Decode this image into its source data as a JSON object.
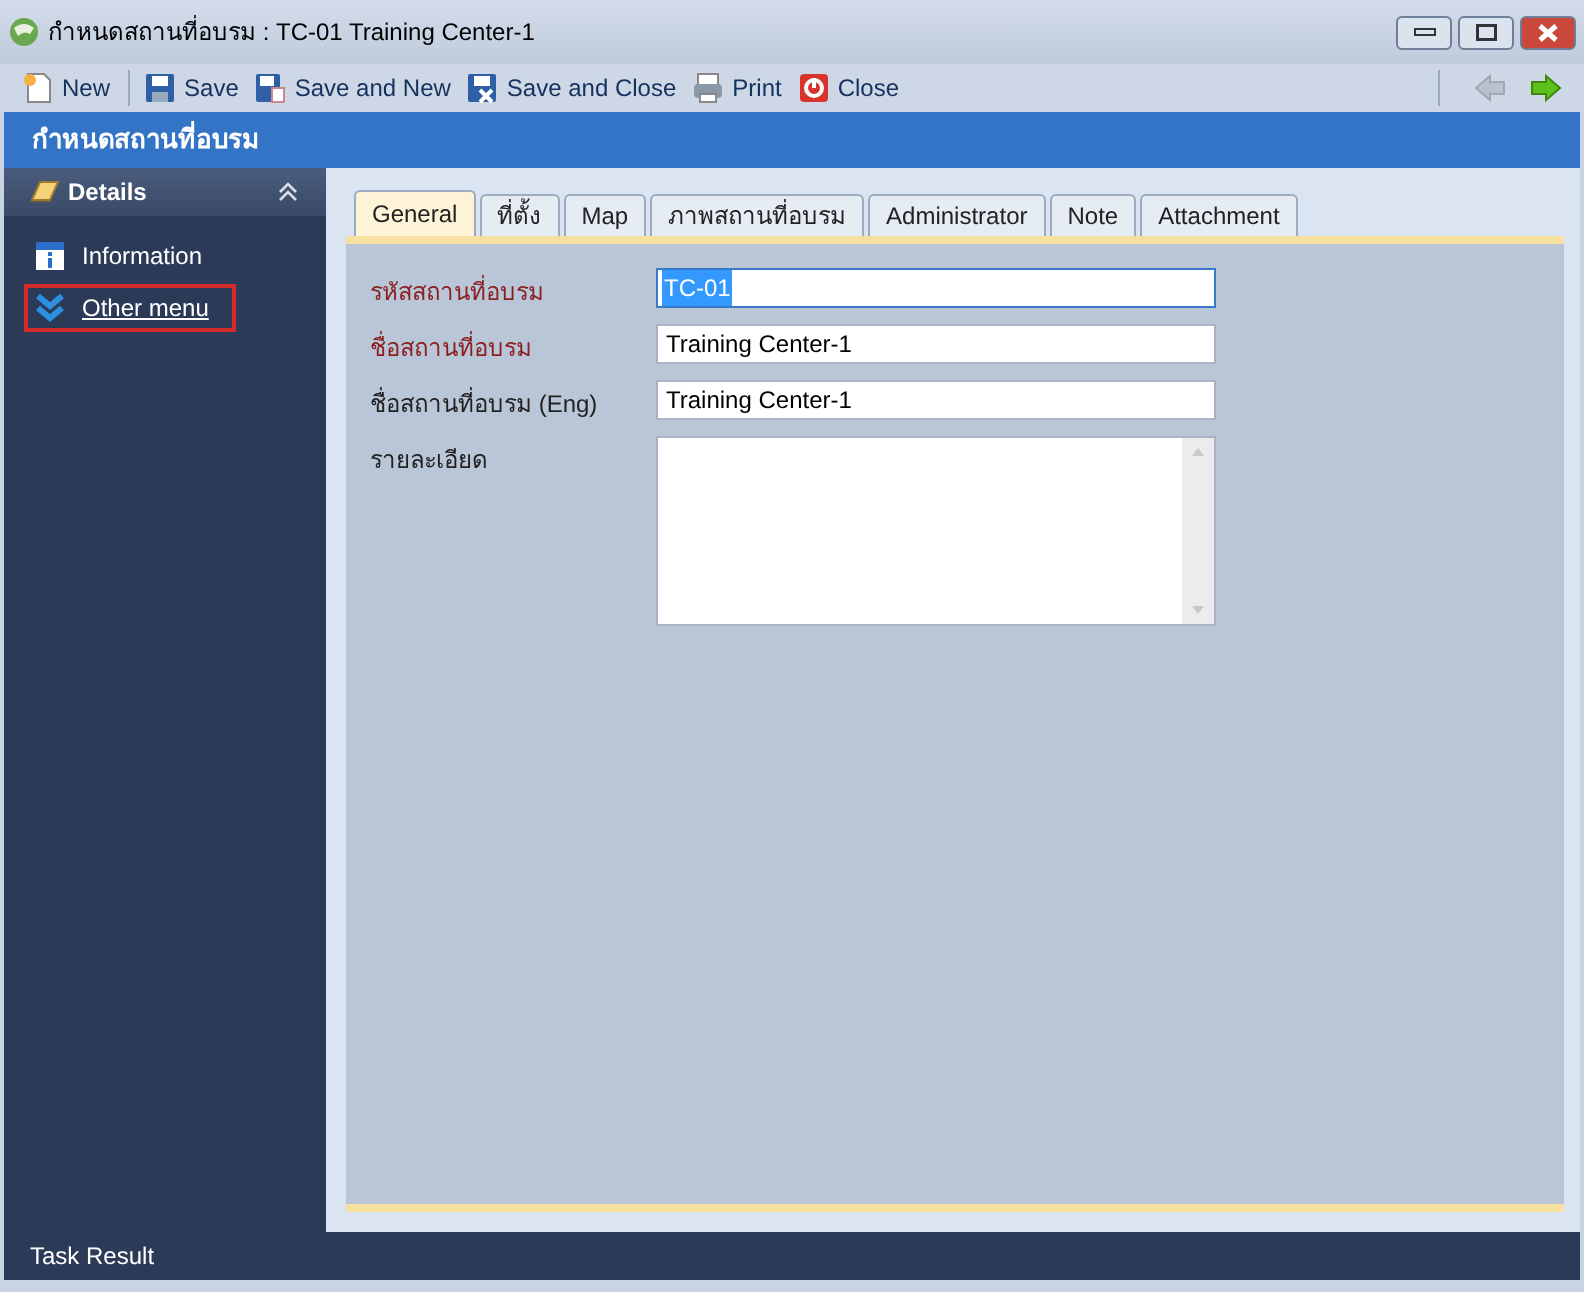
{
  "window": {
    "title": "กำหนดสถานที่อบรม : TC-01 Training Center-1"
  },
  "toolbar": {
    "buttons": [
      {
        "label": "New",
        "kind": "new"
      },
      {
        "label": "Save",
        "kind": "save"
      },
      {
        "label": "Save and New",
        "kind": "save-new"
      },
      {
        "label": "Save and Close",
        "kind": "save-close"
      },
      {
        "label": "Print",
        "kind": "print"
      },
      {
        "label": "Close",
        "kind": "close"
      }
    ],
    "nav": [
      {
        "kind": "back",
        "disabled": true
      },
      {
        "kind": "forward",
        "disabled": false
      }
    ]
  },
  "header": {
    "title": "กำหนดสถานที่อบรม"
  },
  "sidebar": {
    "title": "Details",
    "expanded": true,
    "items": [
      {
        "label": "Information",
        "kind": "info",
        "highlighted": false
      },
      {
        "label": "Other menu",
        "kind": "more",
        "highlighted": true
      }
    ]
  },
  "tabs": [
    {
      "label": "General",
      "selected": true
    },
    {
      "label": "ที่ตั้ง",
      "selected": false
    },
    {
      "label": "Map",
      "selected": false
    },
    {
      "label": "ภาพสถานที่อบรม",
      "selected": false
    },
    {
      "label": "Administrator",
      "selected": false
    },
    {
      "label": "Note",
      "selected": false
    },
    {
      "label": "Attachment",
      "selected": false
    }
  ],
  "fields": [
    {
      "label": "รหัสสถานที่อบรม",
      "value": "TC-01",
      "required": true,
      "selected": true,
      "kind": "text"
    },
    {
      "label": "ชื่อสถานที่อบรม",
      "value": "Training Center-1",
      "required": true,
      "selected": false,
      "kind": "text"
    },
    {
      "label": "ชื่อสถานที่อบรม (Eng)",
      "value": "Training Center-1",
      "required": false,
      "selected": false,
      "kind": "text"
    },
    {
      "label": "รายละเอียด",
      "required": false,
      "selected": false,
      "kind": "textarea"
    }
  ],
  "status_bar": {
    "text": "Task Result"
  }
}
